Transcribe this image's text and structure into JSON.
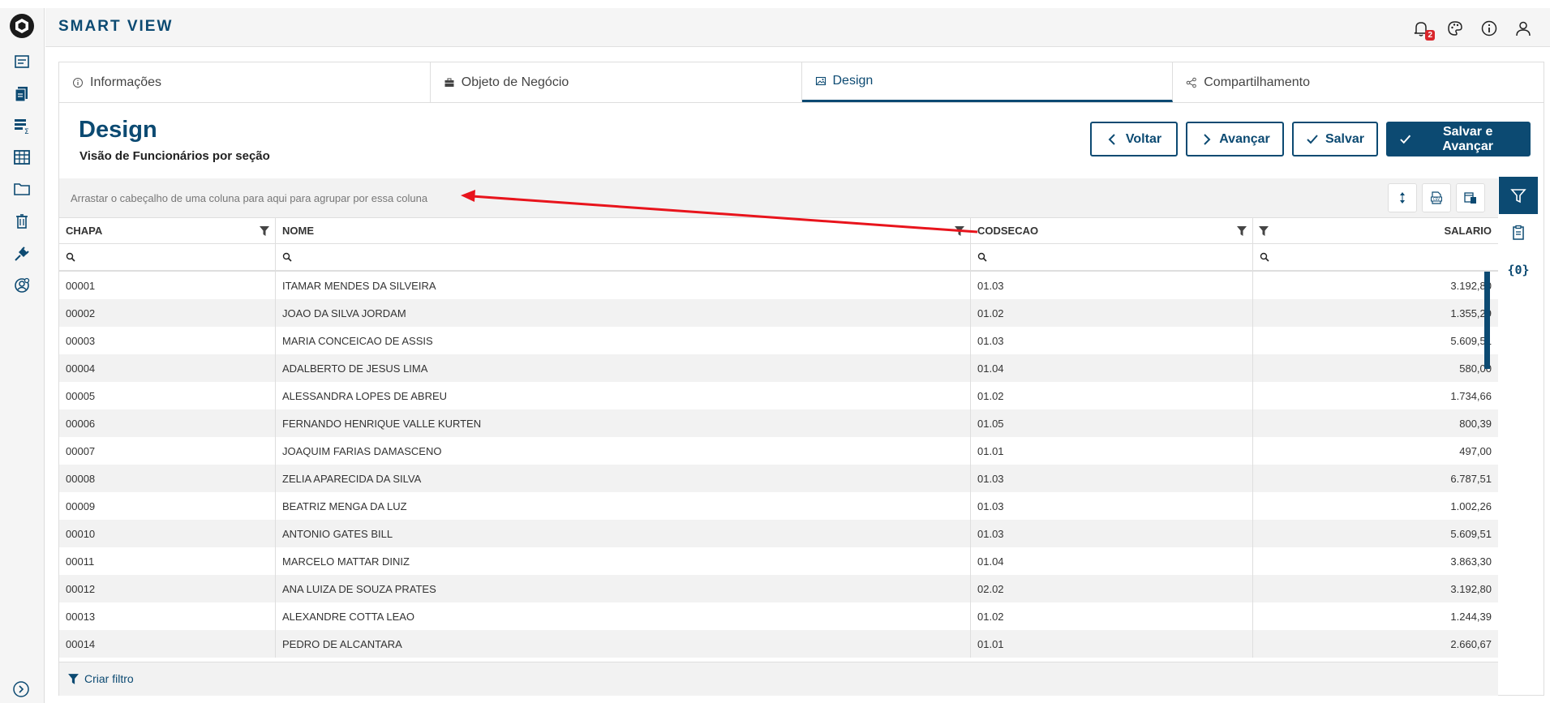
{
  "app": {
    "title": "SMART VIEW",
    "notification_count": "2"
  },
  "rail": {
    "items": [
      "list-icon",
      "documents-icon",
      "sum-icon",
      "table-icon",
      "folder-icon",
      "trash-icon",
      "plug-icon",
      "user-settings-icon"
    ]
  },
  "tabs": [
    {
      "label": "Informações",
      "icon": "info-icon"
    },
    {
      "label": "Objeto de Negócio",
      "icon": "briefcase-icon"
    },
    {
      "label": "Design",
      "icon": "image-icon",
      "active": true
    },
    {
      "label": "Compartilhamento",
      "icon": "share-icon"
    }
  ],
  "header": {
    "title": "Design",
    "subtitle": "Visão de Funcionários por seção",
    "back_label": "Voltar",
    "next_label": "Avançar",
    "save_label": "Salvar",
    "save_next_label": "Salvar e Avançar"
  },
  "grid": {
    "group_hint": "Arrastar o cabeçalho de uma coluna para aqui para agrupar por essa coluna",
    "columns": [
      "CHAPA",
      "NOME",
      "CODSECAO",
      "SALARIO"
    ],
    "rows": [
      [
        "00001",
        "ITAMAR MENDES DA SILVEIRA",
        "01.03",
        "3.192,80"
      ],
      [
        "00002",
        "JOAO DA SILVA JORDAM",
        "01.02",
        "1.355,29"
      ],
      [
        "00003",
        "MARIA CONCEICAO DE ASSIS",
        "01.03",
        "5.609,51"
      ],
      [
        "00004",
        "ADALBERTO DE JESUS LIMA",
        "01.04",
        "580,00"
      ],
      [
        "00005",
        "ALESSANDRA LOPES DE ABREU",
        "01.02",
        "1.734,66"
      ],
      [
        "00006",
        "FERNANDO HENRIQUE VALLE KURTEN",
        "01.05",
        "800,39"
      ],
      [
        "00007",
        "JOAQUIM FARIAS DAMASCENO",
        "01.01",
        "497,00"
      ],
      [
        "00008",
        "ZELIA APARECIDA DA SILVA",
        "01.03",
        "6.787,51"
      ],
      [
        "00009",
        "BEATRIZ MENGA DA LUZ",
        "01.03",
        "1.002,26"
      ],
      [
        "00010",
        "ANTONIO GATES BILL",
        "01.03",
        "5.609,51"
      ],
      [
        "00011",
        "MARCELO MATTAR DINIZ",
        "01.04",
        "3.863,30"
      ],
      [
        "00012",
        "ANA LUIZA DE SOUZA PRATES",
        "02.02",
        "3.192,80"
      ],
      [
        "00013",
        "ALEXANDRE COTTA LEAO",
        "01.02",
        "1.244,39"
      ],
      [
        "00014",
        "PEDRO DE ALCANTARA",
        "01.01",
        "2.660,67"
      ]
    ],
    "create_filter_label": "Criar filtro"
  },
  "colors": {
    "primary": "#0c4a72",
    "annotation": "#e8141c"
  }
}
